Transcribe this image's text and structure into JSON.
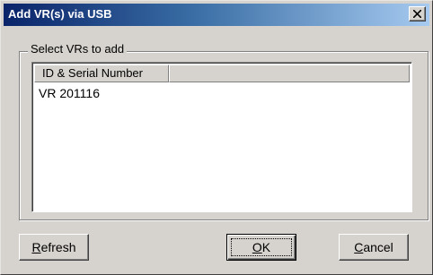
{
  "window": {
    "title": "Add VR(s) via USB"
  },
  "group": {
    "label": "Select VRs to add"
  },
  "list": {
    "columns": [
      "ID & Serial Number",
      ""
    ],
    "items": [
      "VR 201116"
    ]
  },
  "buttons": {
    "refresh_mnemonic": "R",
    "refresh_rest": "efresh",
    "ok_mnemonic": "O",
    "ok_rest": "K",
    "cancel_mnemonic": "C",
    "cancel_rest": "ancel"
  },
  "icons": {
    "close": "close-icon"
  },
  "colors": {
    "titlebar_start": "#0a246a",
    "titlebar_end": "#a6caf0",
    "face": "#d6d3ce"
  }
}
